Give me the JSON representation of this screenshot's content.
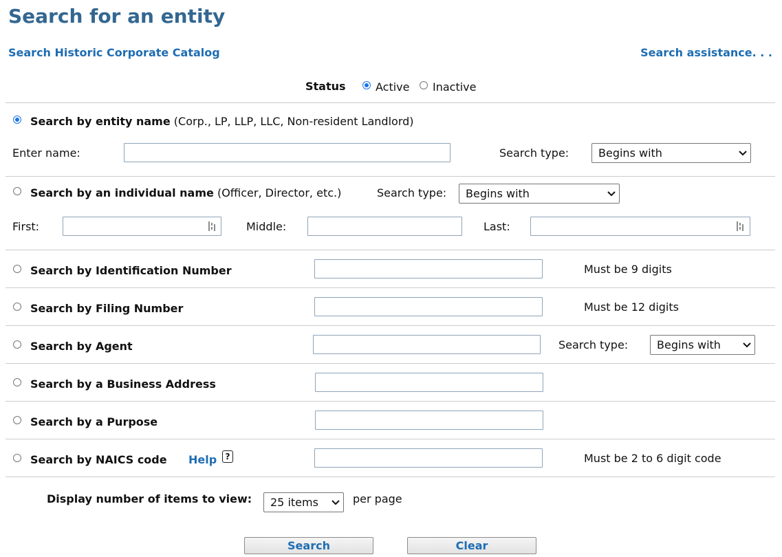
{
  "header": {
    "title": "Search for an entity",
    "historic_link": "Search Historic Corporate Catalog",
    "assistance_link": "Search assistance. . ."
  },
  "status": {
    "label": "Status",
    "options": [
      "Active",
      "Inactive"
    ],
    "selected": "Active"
  },
  "entity_name": {
    "label": "Search by entity name",
    "note": "(Corp., LP, LLP, LLC, Non-resident Landlord)",
    "field_label": "Enter name:",
    "value": "",
    "search_type_label": "Search type:",
    "search_type": "Begins with"
  },
  "individual_name": {
    "label": "Search by an individual name",
    "note": "(Officer, Director, etc.)",
    "search_type_label": "Search type:",
    "search_type": "Begins with",
    "first_label": "First:",
    "middle_label": "Middle:",
    "last_label": "Last:",
    "first_value": "",
    "middle_value": "",
    "last_value": ""
  },
  "identification": {
    "label": "Search by Identification Number",
    "value": "",
    "hint": "Must be 9 digits"
  },
  "filing": {
    "label": "Search by Filing Number",
    "value": "",
    "hint": "Must be 12 digits"
  },
  "agent": {
    "label": "Search by Agent",
    "value": "",
    "search_type_label": "Search type:",
    "search_type": "Begins with"
  },
  "business_address": {
    "label": "Search by a Business Address",
    "value": ""
  },
  "purpose": {
    "label": "Search by a Purpose",
    "value": ""
  },
  "naics": {
    "label": "Search by NAICS code",
    "help_label": "Help",
    "help_icon": "?",
    "value": "",
    "hint": "Must be 2 to 6 digit code"
  },
  "display": {
    "label": "Display number of items to view:",
    "selected": "25 items",
    "suffix": "per page"
  },
  "buttons": {
    "search": "Search",
    "clear": "Clear"
  },
  "colors": {
    "title": "#336791",
    "link": "#1e6db3",
    "radio_selected": "#1a73e8"
  },
  "selected_search_mode": "entity_name"
}
